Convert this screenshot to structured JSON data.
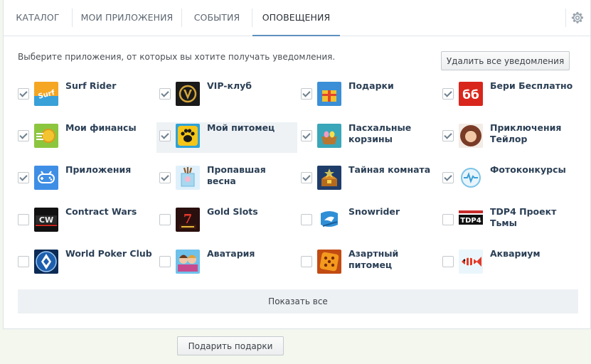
{
  "tabs": [
    {
      "label": "Каталог",
      "active": false
    },
    {
      "label": "Мои приложения",
      "active": false
    },
    {
      "label": "События",
      "active": false
    },
    {
      "label": "Оповещения",
      "active": true
    }
  ],
  "hint_text": "Выберите приложения, от которых вы хотите получать уведомления.",
  "delete_all_label": "Удалить все уведомления",
  "apps": [
    {
      "name": "Surf Rider",
      "checked": true,
      "icon": "surf-rider-icon"
    },
    {
      "name": "VIP-клуб",
      "checked": true,
      "icon": "vip-club-icon"
    },
    {
      "name": "Подарки",
      "checked": true,
      "icon": "gifts-icon"
    },
    {
      "name": "Бери Бесплатно",
      "checked": true,
      "icon": "beri-besplatno-icon"
    },
    {
      "name": "Мои финансы",
      "checked": true,
      "icon": "finances-icon"
    },
    {
      "name": "Мой питомец",
      "checked": true,
      "icon": "pet-paw-icon",
      "highlight": true
    },
    {
      "name": "Пасхальные корзины",
      "checked": true,
      "icon": "easter-baskets-icon"
    },
    {
      "name": "Приключения Тейлор",
      "checked": true,
      "icon": "taylor-adventures-icon"
    },
    {
      "name": "Приложения",
      "checked": true,
      "icon": "gamepad-icon"
    },
    {
      "name": "Пропавшая весна",
      "checked": true,
      "icon": "lost-spring-icon"
    },
    {
      "name": "Тайная комната",
      "checked": true,
      "icon": "secret-room-icon"
    },
    {
      "name": "Фотоконкурсы",
      "checked": true,
      "icon": "photo-contest-icon"
    },
    {
      "name": "Contract Wars",
      "checked": false,
      "icon": "contract-wars-icon"
    },
    {
      "name": "Gold Slots",
      "checked": false,
      "icon": "gold-slots-icon"
    },
    {
      "name": "Snowrider",
      "checked": false,
      "icon": "snowrider-icon"
    },
    {
      "name": "TDP4 Проект Тьмы",
      "checked": false,
      "icon": "tdp4-icon"
    },
    {
      "name": "World Poker Club",
      "checked": false,
      "icon": "world-poker-club-icon"
    },
    {
      "name": "Аватария",
      "checked": false,
      "icon": "avataria-icon"
    },
    {
      "name": "Азартный питомец",
      "checked": false,
      "icon": "gambling-pet-icon"
    },
    {
      "name": "Аквариум",
      "checked": false,
      "icon": "aquarium-icon"
    }
  ],
  "show_all_label": "Показать все",
  "gift_button_label": "Подарить подарки"
}
